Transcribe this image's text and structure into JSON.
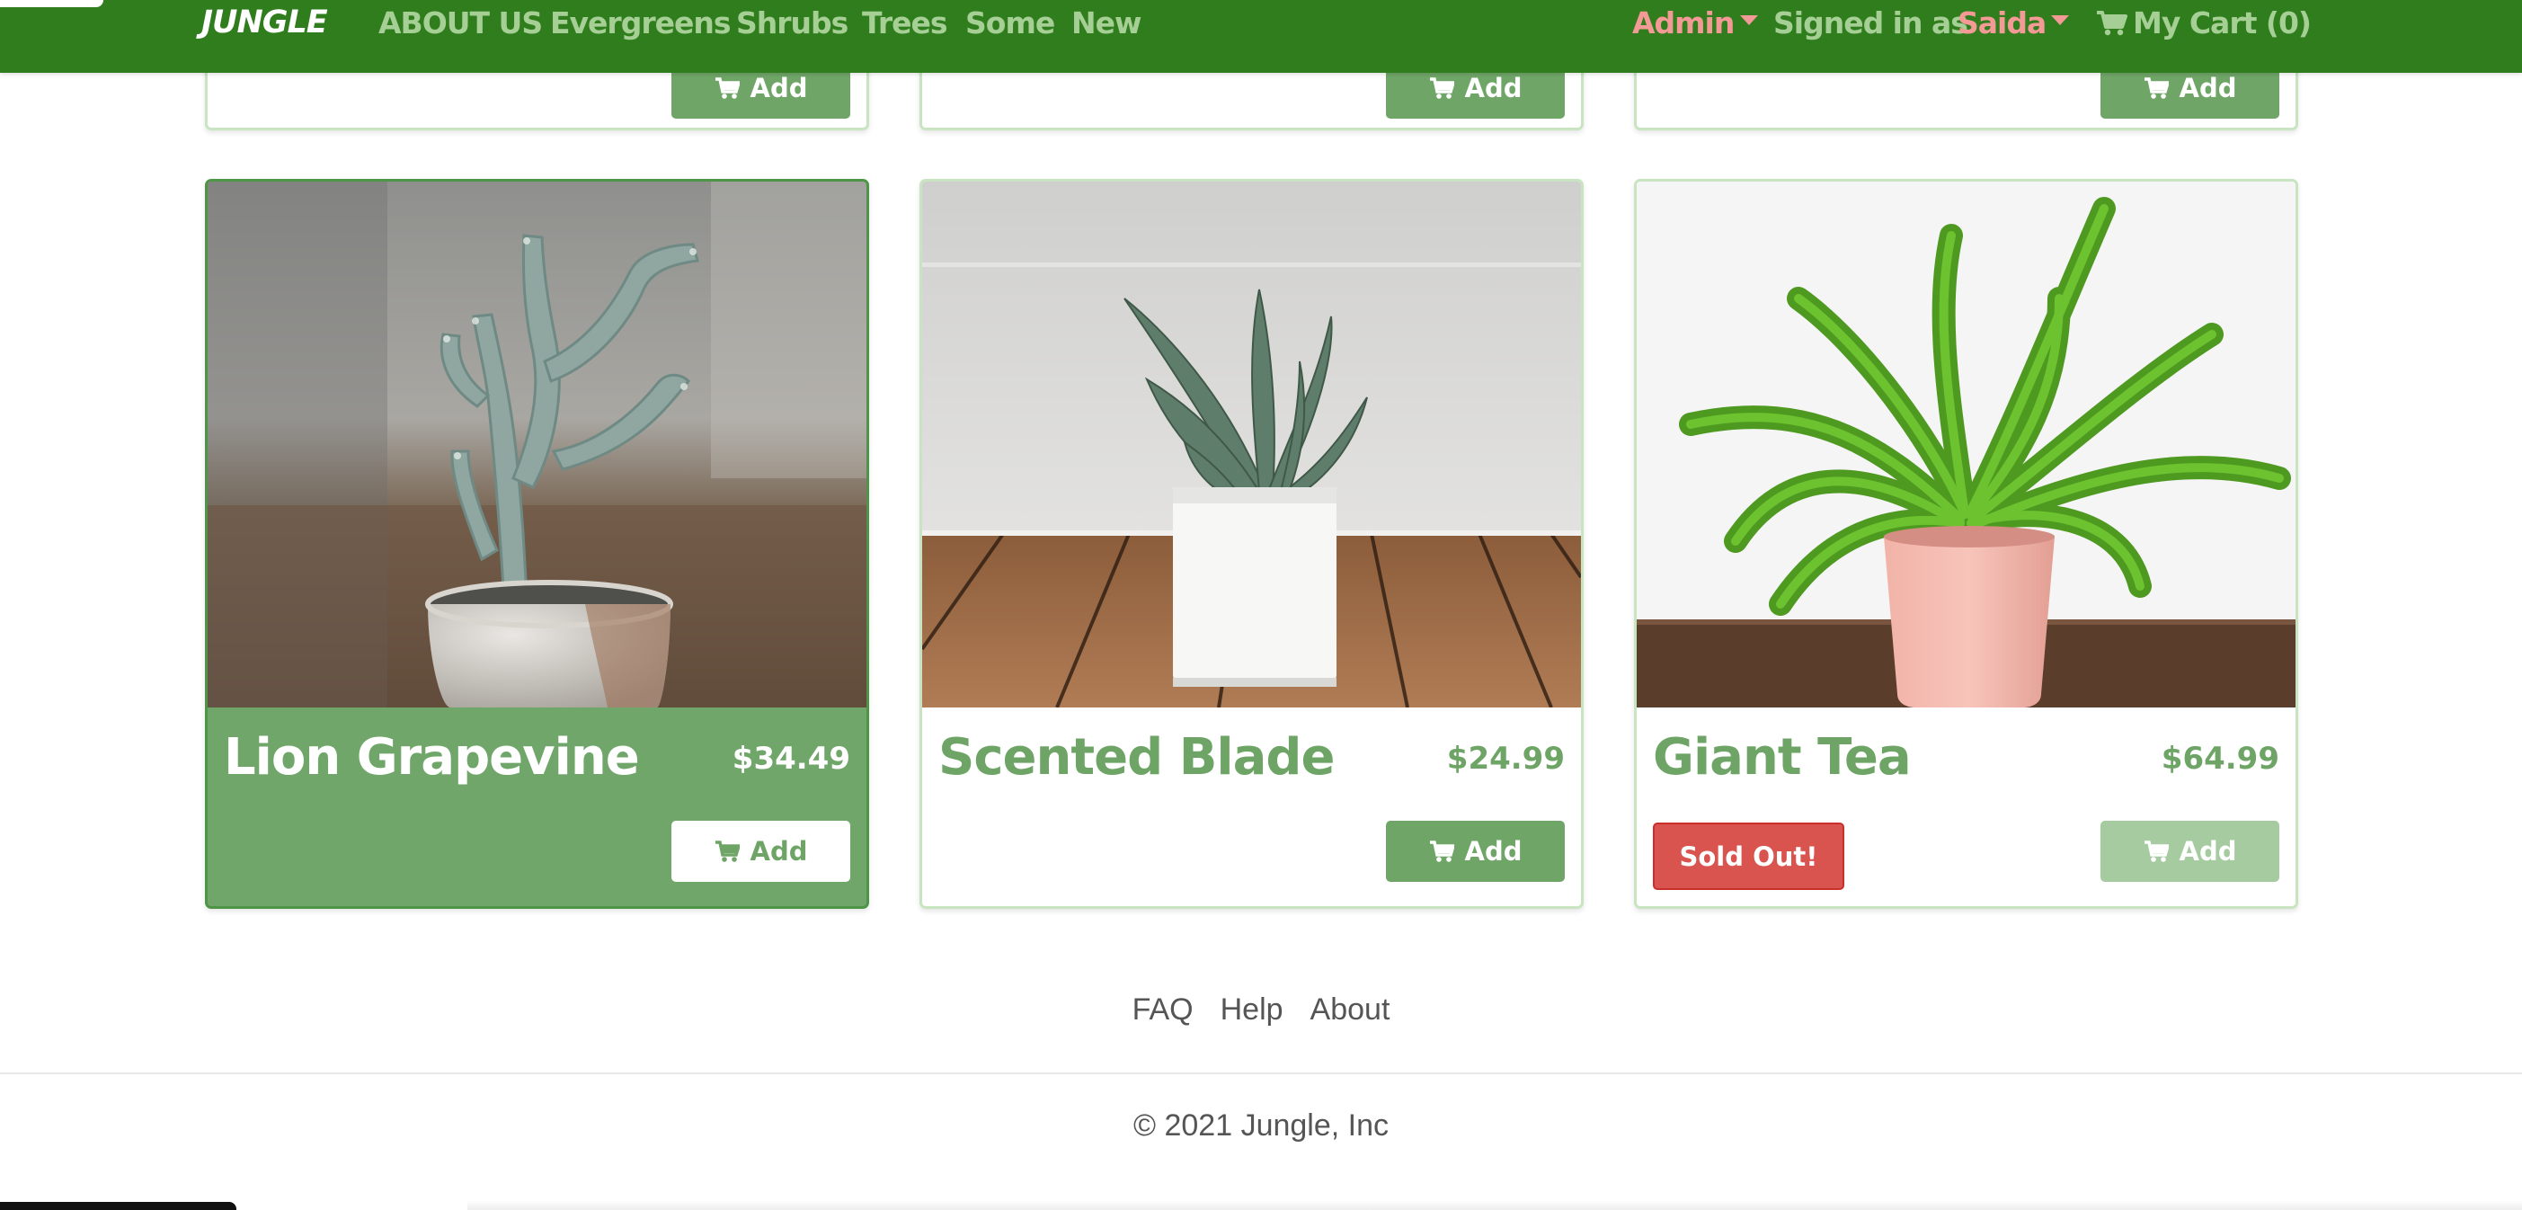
{
  "nav": {
    "brand": "JUNGLE",
    "links": [
      "ABOUT US",
      "Evergreens",
      "Shrubs",
      "Trees",
      "Some",
      "New"
    ],
    "admin": "Admin",
    "signed_in_prefix": "Signed in as",
    "user": "Saida",
    "cart": "My Cart (0)"
  },
  "top_row": {
    "add_label": "Add"
  },
  "products": [
    {
      "name": "Lion Grapevine",
      "price": "$34.49",
      "add_label": "Add"
    },
    {
      "name": "Scented Blade",
      "price": "$24.99",
      "add_label": "Add"
    },
    {
      "name": "Giant Tea",
      "price": "$64.99",
      "add_label": "Add",
      "sold_out": "Sold Out!"
    }
  ],
  "footer": {
    "links": [
      "FAQ",
      "Help",
      "About"
    ],
    "copyright": "© 2021 Jungle, Inc"
  },
  "colors": {
    "navbar": "#2f7d1c",
    "nav_link": "#a6cf96",
    "accent_pink": "#f49a96",
    "card_green": "#71a66b",
    "button_green": "#6fa567",
    "sold_out_red": "#d9534f"
  },
  "icons": [
    "cart-icon",
    "caret-down-icon"
  ]
}
